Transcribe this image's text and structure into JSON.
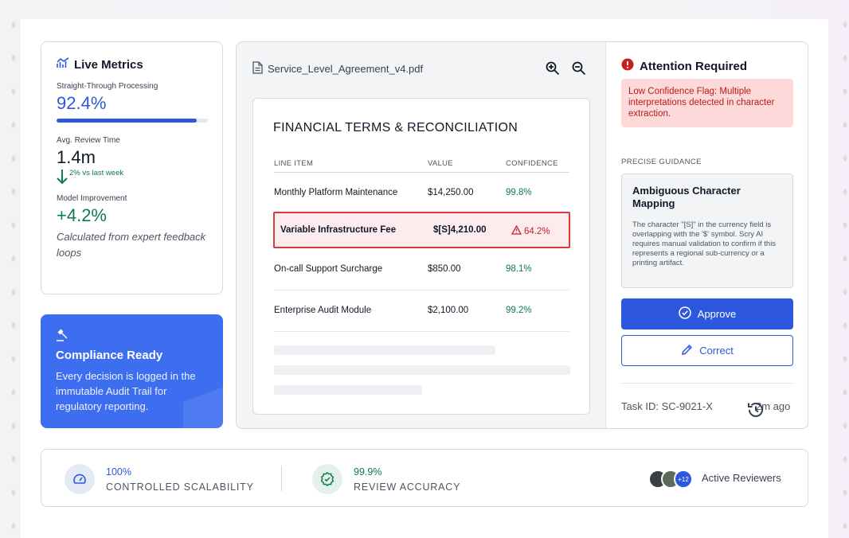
{
  "metrics": {
    "title": "Live Metrics",
    "stp_label": "Straight-Through Processing",
    "stp_value": "92.4%",
    "stp_progress": 0.924,
    "review_label": "Avg. Review Time",
    "review_value": "1.4m",
    "review_trend": "2% vs last week",
    "improve_label": "Model Improvement",
    "improve_value": "+4.2%",
    "improve_note": "Calculated from expert feedback loops"
  },
  "compliance": {
    "title": "Compliance Ready",
    "text": "Every decision is logged in the immutable Audit Trail for regulatory reporting."
  },
  "viewer": {
    "filename": "Service_Level_Agreement_v4.pdf",
    "doc_title": "FINANCIAL TERMS & RECONCILIATION",
    "columns": [
      "LINE ITEM",
      "VALUE",
      "CONFIDENCE"
    ],
    "rows": [
      {
        "item": "Monthly Platform Maintenance",
        "value": "$14,250.00",
        "confidence": "99.8%"
      },
      {
        "item": "Variable Infrastructure Fee",
        "value": "$[S]4,210.00",
        "confidence": "64.2%"
      },
      {
        "item": "On-call Support Surcharge",
        "value": "$850.00",
        "confidence": "98.1%"
      },
      {
        "item": "Enterprise Audit Module",
        "value": "$2,100.00",
        "confidence": "99.2%"
      }
    ]
  },
  "attention": {
    "title": "Attention Required",
    "alert": "Low Confidence Flag: Multiple interpretations detected in character extraction.",
    "guidance_label": "PRECISE GUIDANCE",
    "guidance_title": "Ambiguous Character Mapping",
    "guidance_text": "The character \"[S]\" in the currency field is overlapping with the '$' symbol. Scry AI requires manual validation to confirm if this represents a regional sub-currency or a printing artifact.",
    "approve_label": "Approve",
    "correct_label": "Correct",
    "task_id": "Task ID: SC-9021-X",
    "time_ago": "2m ago"
  },
  "stats": {
    "scalability_value": "100%",
    "scalability_label": "CONTROLLED SCALABILITY",
    "accuracy_value": "99.9%",
    "accuracy_label": "REVIEW ACCURACY",
    "avatar_more": "+12",
    "reviewers_label": "Active Reviewers"
  },
  "colors": {
    "accent": "#2d57dd",
    "compliance_bg": "#3d6ef0",
    "success": "#0f7a4d",
    "danger": "#d93a3a",
    "alert_bg": "#fdd9d9"
  },
  "icons": [
    "chart-icon",
    "arrow-down-icon",
    "gavel-icon",
    "file-icon",
    "zoom-in-icon",
    "zoom-out-icon",
    "warning-icon",
    "alert-circle-icon",
    "check-circle-icon",
    "pencil-icon",
    "history-icon",
    "gauge-icon",
    "badge-check-icon"
  ]
}
